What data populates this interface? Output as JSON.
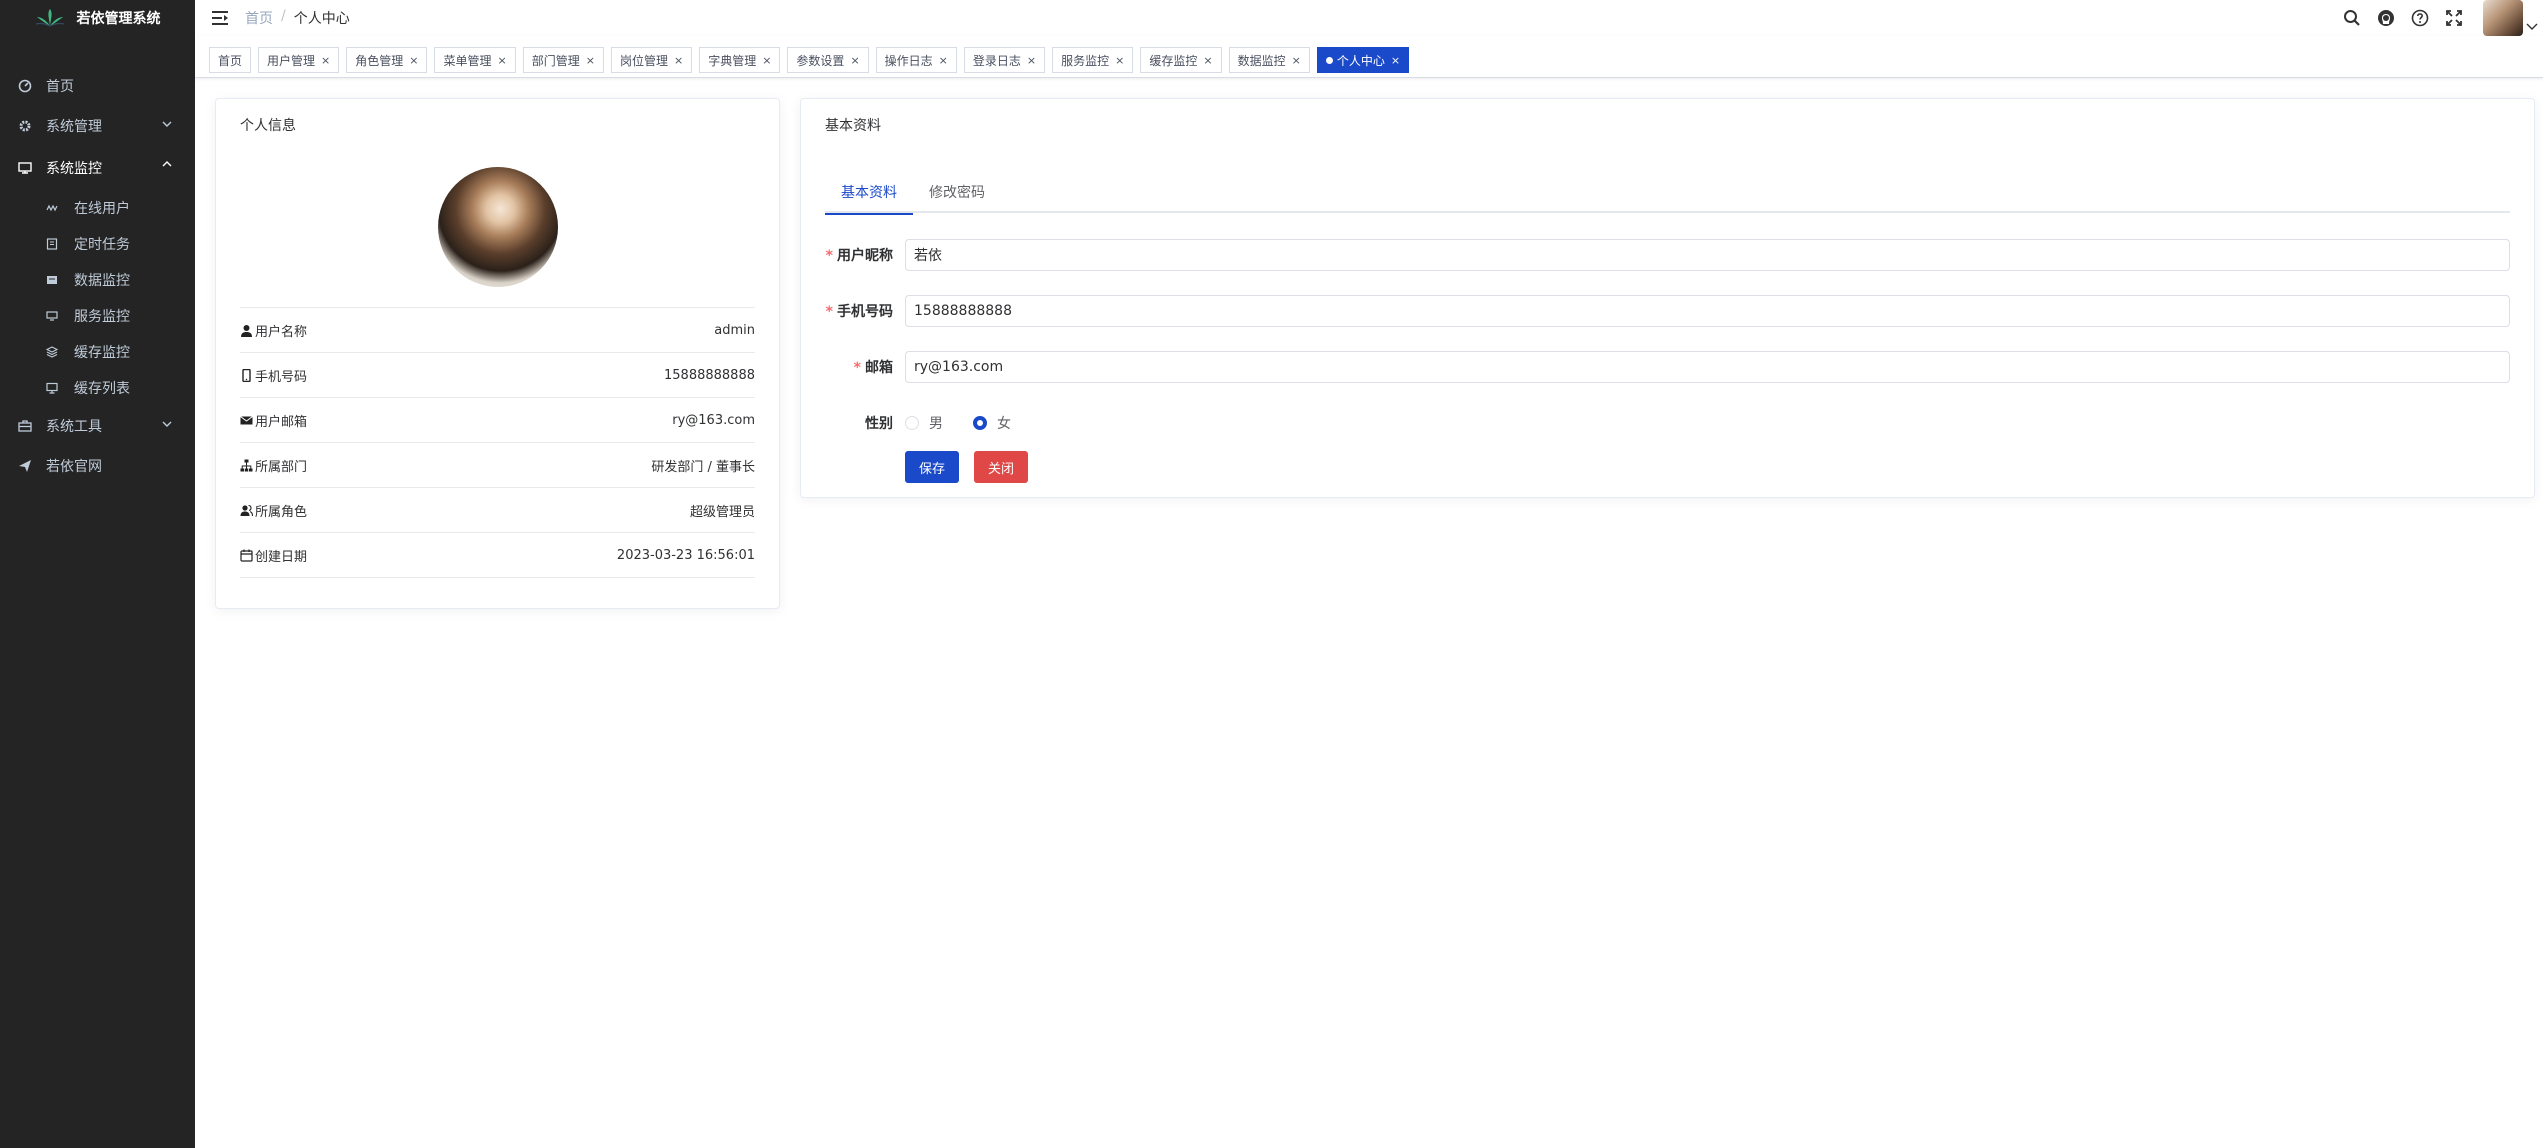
{
  "app": {
    "title": "若依管理系统"
  },
  "sidebar": {
    "items": [
      {
        "label": "首页",
        "icon": "dashboard-icon"
      },
      {
        "label": "系统管理",
        "icon": "gear-icon"
      },
      {
        "label": "系统监控",
        "icon": "monitor-icon"
      },
      {
        "label": "系统工具",
        "icon": "toolbox-icon"
      },
      {
        "label": "若依官网",
        "icon": "send-icon"
      }
    ],
    "submenu": [
      {
        "label": "在线用户",
        "icon": "online-icon"
      },
      {
        "label": "定时任务",
        "icon": "job-icon"
      },
      {
        "label": "数据监控",
        "icon": "druid-icon"
      },
      {
        "label": "服务监控",
        "icon": "server-icon"
      },
      {
        "label": "缓存监控",
        "icon": "redis-icon"
      },
      {
        "label": "缓存列表",
        "icon": "redis-list-icon"
      }
    ]
  },
  "navbar": {
    "breadcrumb": {
      "home": "首页",
      "sep": "/",
      "current": "个人中心"
    }
  },
  "tags": [
    {
      "label": "首页",
      "closable": false
    },
    {
      "label": "用户管理",
      "closable": true
    },
    {
      "label": "角色管理",
      "closable": true
    },
    {
      "label": "菜单管理",
      "closable": true
    },
    {
      "label": "部门管理",
      "closable": true
    },
    {
      "label": "岗位管理",
      "closable": true
    },
    {
      "label": "字典管理",
      "closable": true
    },
    {
      "label": "参数设置",
      "closable": true
    },
    {
      "label": "操作日志",
      "closable": true
    },
    {
      "label": "登录日志",
      "closable": true
    },
    {
      "label": "服务监控",
      "closable": true
    },
    {
      "label": "缓存监控",
      "closable": true
    },
    {
      "label": "数据监控",
      "closable": true
    },
    {
      "label": "个人中心",
      "closable": true,
      "active": true
    }
  ],
  "tag_close": "×",
  "profile": {
    "title": "个人信息",
    "rows": [
      {
        "label": "用户名称",
        "value": "admin"
      },
      {
        "label": "手机号码",
        "value": "15888888888"
      },
      {
        "label": "用户邮箱",
        "value": "ry@163.com"
      },
      {
        "label": "所属部门",
        "value": "研发部门 / 董事长"
      },
      {
        "label": "所属角色",
        "value": "超级管理员"
      },
      {
        "label": "创建日期",
        "value": "2023-03-23 16:56:01"
      }
    ]
  },
  "basic": {
    "title": "基本资料",
    "tabs": [
      "基本资料",
      "修改密码"
    ],
    "required_mark": "*",
    "fields": {
      "nickname": {
        "label": "用户昵称",
        "value": "若依"
      },
      "phone": {
        "label": "手机号码",
        "value": "15888888888"
      },
      "email": {
        "label": "邮箱",
        "value": "ry@163.com"
      }
    },
    "gender": {
      "label": "性别",
      "options": [
        "男",
        "女"
      ],
      "selected": "女"
    },
    "save_label": "保存",
    "close_label": "关闭"
  },
  "colors": {
    "primary": "#1a49c9",
    "danger": "#e04848",
    "sidebar": "#242424"
  }
}
